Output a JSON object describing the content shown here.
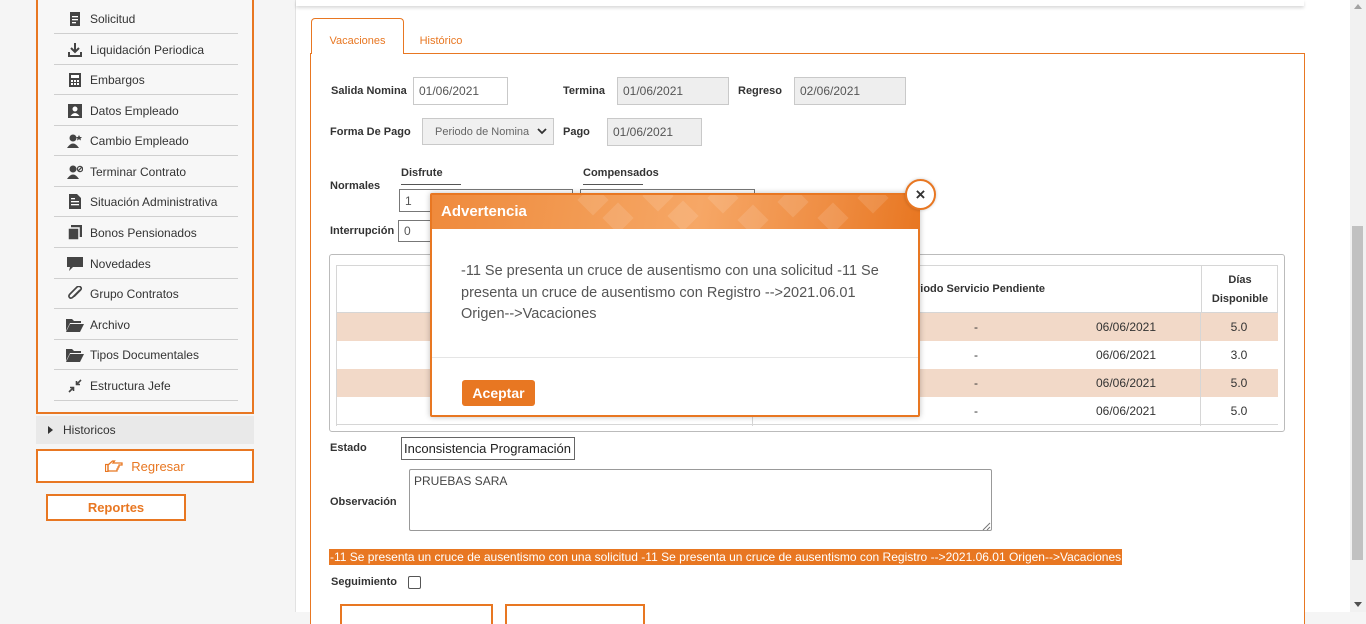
{
  "colors": {
    "accent": "#e87722",
    "row_alt": "#f2d9c8"
  },
  "sidebar": {
    "items": [
      {
        "label": "Solicitud",
        "icon": "document-icon"
      },
      {
        "label": "Liquidación Periodica",
        "icon": "download-icon"
      },
      {
        "label": "Embargos",
        "icon": "calculator-icon"
      },
      {
        "label": "Datos Empleado",
        "icon": "id-card-icon"
      },
      {
        "label": "Cambio Empleado",
        "icon": "user-change-icon"
      },
      {
        "label": "Terminar Contrato",
        "icon": "user-remove-icon"
      },
      {
        "label": "Situación Administrativa",
        "icon": "file-text-icon"
      },
      {
        "label": "Bonos Pensionados",
        "icon": "copy-icon"
      },
      {
        "label": "Novedades",
        "icon": "comment-icon"
      },
      {
        "label": "Grupo Contratos",
        "icon": "paperclip-icon"
      },
      {
        "label": "Archivo",
        "icon": "folder-open-icon"
      },
      {
        "label": "Tipos Documentales",
        "icon": "folder-open-icon"
      },
      {
        "label": "Estructura Jefe",
        "icon": "compress-icon"
      }
    ],
    "historicos": "Historicos",
    "regresar": "Regresar",
    "reportes": "Reportes"
  },
  "tabs": {
    "vacaciones": "Vacaciones",
    "historico": "Histórico"
  },
  "form": {
    "salida_nomina_label": "Salida Nomina",
    "salida_nomina_value": "01/06/2021",
    "termina_label": "Termina",
    "termina_value": "01/06/2021",
    "regreso_label": "Regreso",
    "regreso_value": "02/06/2021",
    "forma_pago_label": "Forma De Pago",
    "forma_pago_value": "Periodo de Nomina",
    "pago_label": "Pago",
    "pago_value": "01/06/2021",
    "disfrute_label": "Disfrute",
    "compensados_label": "Compensados",
    "normales_label": "Normales",
    "normales_value": "1",
    "interrupcion_label": "Interrupción",
    "interrupcion_value": "0",
    "estado_label": "Estado",
    "estado_value": "Inconsistencia Programación",
    "observacion_label": "Observación",
    "observacion_value": "PRUEBAS SARA",
    "error_message": "-11 Se presenta un cruce de ausentismo con una solicitud -11 Se presenta un cruce de ausentismo con Registro -->2021.06.01 Origen-->Vacaciones",
    "seguimiento_label": "Seguimiento"
  },
  "grid": {
    "header_periodo": "Periodo Servicio Pendiente",
    "header_periodo_visible": "riodo Servicio Pendiente",
    "header_dias_1": "Días",
    "header_dias_2": "Disponible",
    "rows": [
      {
        "dash": "-",
        "date": "06/06/2021",
        "dias": "5.0"
      },
      {
        "dash": "-",
        "date": "06/06/2021",
        "dias": "3.0"
      },
      {
        "dash": "-",
        "date": "06/06/2021",
        "dias": "5.0"
      },
      {
        "dash": "-",
        "date": "06/06/2021",
        "dias": "5.0"
      }
    ]
  },
  "modal": {
    "title": "Advertencia",
    "message": "-11 Se presenta un cruce de ausentismo con una solicitud -11 Se presenta un cruce de ausentismo con Registro -->2021.06.01 Origen-->Vacaciones",
    "ok_label": "Aceptar",
    "close_glyph": "×"
  }
}
